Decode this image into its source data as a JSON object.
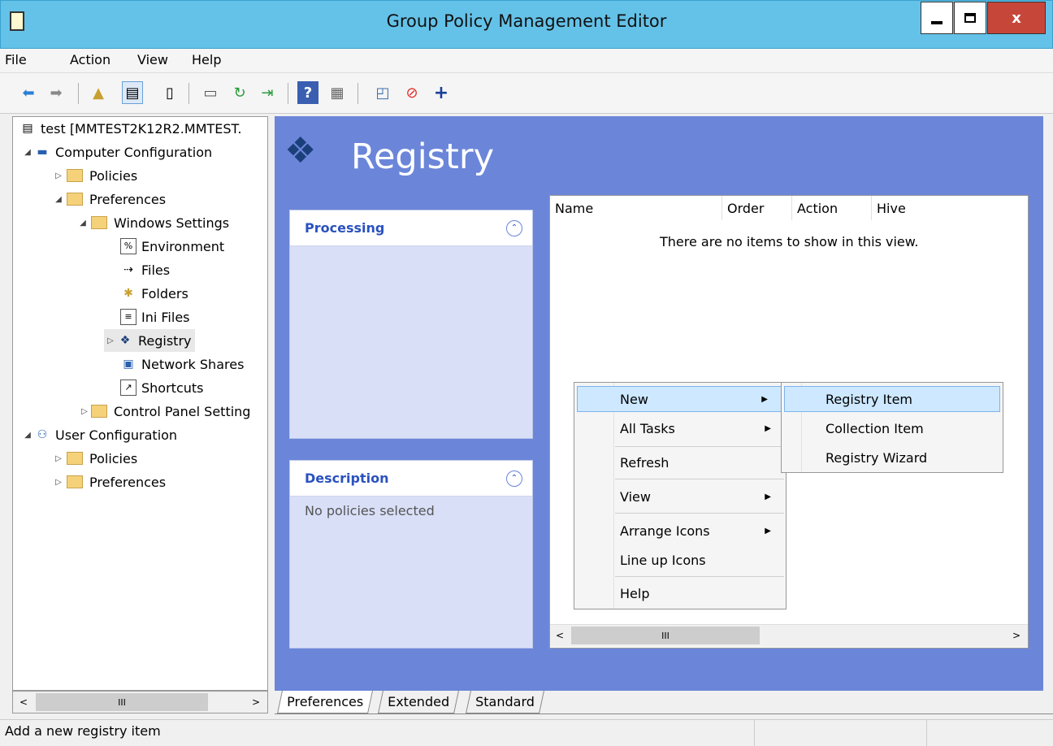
{
  "window": {
    "title": "Group Policy Management Editor",
    "close": "x"
  },
  "menu": [
    "File",
    "Action",
    "View",
    "Help"
  ],
  "tree": {
    "root": "test [MMTEST2K12R2.MMTEST.",
    "computer": "Computer Configuration",
    "policies": "Policies",
    "preferences": "Preferences",
    "windows_settings": "Windows Settings",
    "environment": "Environment",
    "files": "Files",
    "folders": "Folders",
    "ini_files": "Ini Files",
    "registry": "Registry",
    "network_shares": "Network Shares",
    "shortcuts": "Shortcuts",
    "control_panel": "Control Panel Setting",
    "user": "User Configuration",
    "user_policies": "Policies",
    "user_preferences": "Preferences",
    "hscroll_mark": "III"
  },
  "main": {
    "title": "Registry",
    "processing": "Processing",
    "description": "Description",
    "no_policies": "No policies selected",
    "columns": [
      "Name",
      "Order",
      "Action",
      "Hive"
    ],
    "empty": "There are no items to show in this view.",
    "hscroll_mark": "III"
  },
  "context_menu": [
    "New",
    "All Tasks",
    "Refresh",
    "View",
    "Arrange Icons",
    "Line up Icons",
    "Help"
  ],
  "submenu": [
    "Registry Item",
    "Collection Item",
    "Registry Wizard"
  ],
  "tabs": [
    "Preferences",
    "Extended",
    "Standard"
  ],
  "status": "Add a new registry item",
  "colors": {
    "titlebar": "#64c2e8",
    "main_bg": "#6b86d9",
    "highlight": "#cde8ff"
  }
}
